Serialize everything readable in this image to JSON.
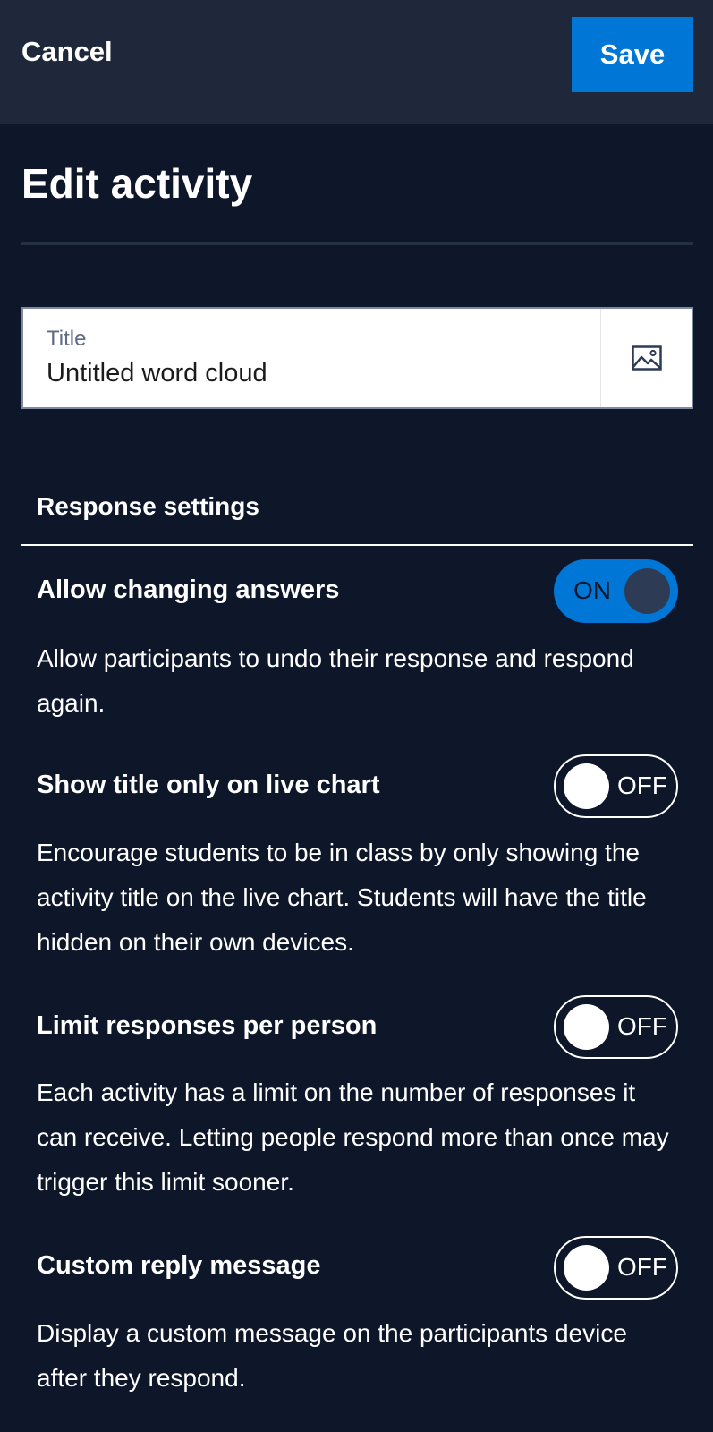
{
  "header": {
    "cancel_label": "Cancel",
    "save_label": "Save"
  },
  "page": {
    "title": "Edit activity"
  },
  "title_field": {
    "label": "Title",
    "value": "Untitled word cloud",
    "image_icon": "image-icon"
  },
  "response_settings": {
    "heading": "Response settings",
    "items": [
      {
        "name": "Allow changing answers",
        "description": "Allow participants to undo their response and respond again.",
        "toggle_state": "ON"
      },
      {
        "name": "Show title only on live chart",
        "description": "Encourage students to be in class by only showing the activity title on the live chart. Students will have the title hidden on their own devices.",
        "toggle_state": "OFF"
      },
      {
        "name": "Limit responses per person",
        "description": "Each activity has a limit on the number of responses it can receive. Letting people respond more than once may trigger this limit sooner.",
        "toggle_state": "OFF"
      },
      {
        "name": "Custom reply message",
        "description": "Display a custom message on the participants device after they respond.",
        "toggle_state": "OFF"
      }
    ]
  },
  "colors": {
    "background": "#0e1629",
    "header_bg": "#1f283a",
    "accent": "#0076d6"
  }
}
